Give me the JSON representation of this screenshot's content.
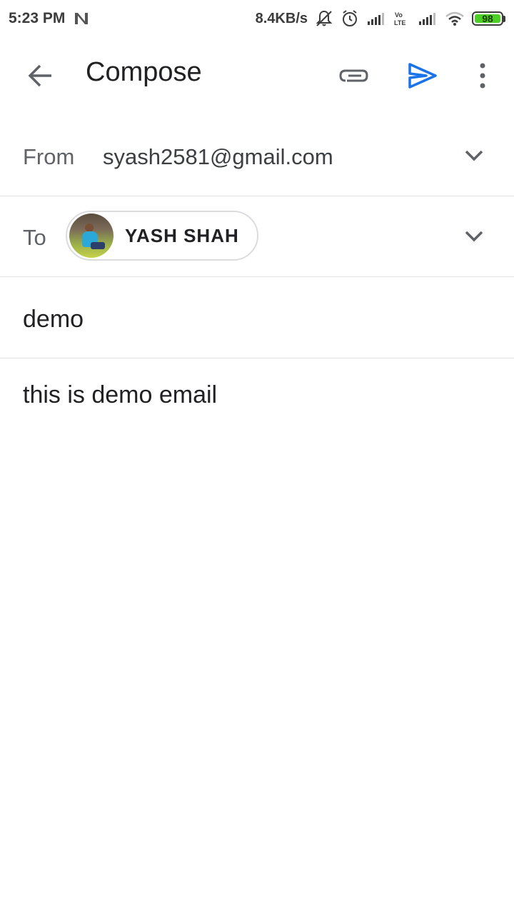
{
  "status_bar": {
    "time": "5:23 PM",
    "network_speed": "8.4KB/s",
    "battery_level": "98",
    "icons": [
      "n-logo-icon",
      "notification-muted-icon",
      "alarm-icon",
      "signal-icon",
      "volte-icon",
      "signal-icon-2",
      "wifi-icon",
      "battery-icon"
    ],
    "battery_color": "#4cd025"
  },
  "app_bar": {
    "title": "Compose",
    "icons": {
      "back": "arrow-back-icon",
      "attach": "paperclip-icon",
      "send": "send-icon",
      "more": "more-vert-icon"
    },
    "send_color": "#1a73e8"
  },
  "from": {
    "label": "From",
    "value": "syash2581@gmail.com"
  },
  "to": {
    "label": "To",
    "recipient_name": "YASH SHAH"
  },
  "subject": {
    "value": "demo"
  },
  "body": {
    "value": "this is demo email"
  }
}
